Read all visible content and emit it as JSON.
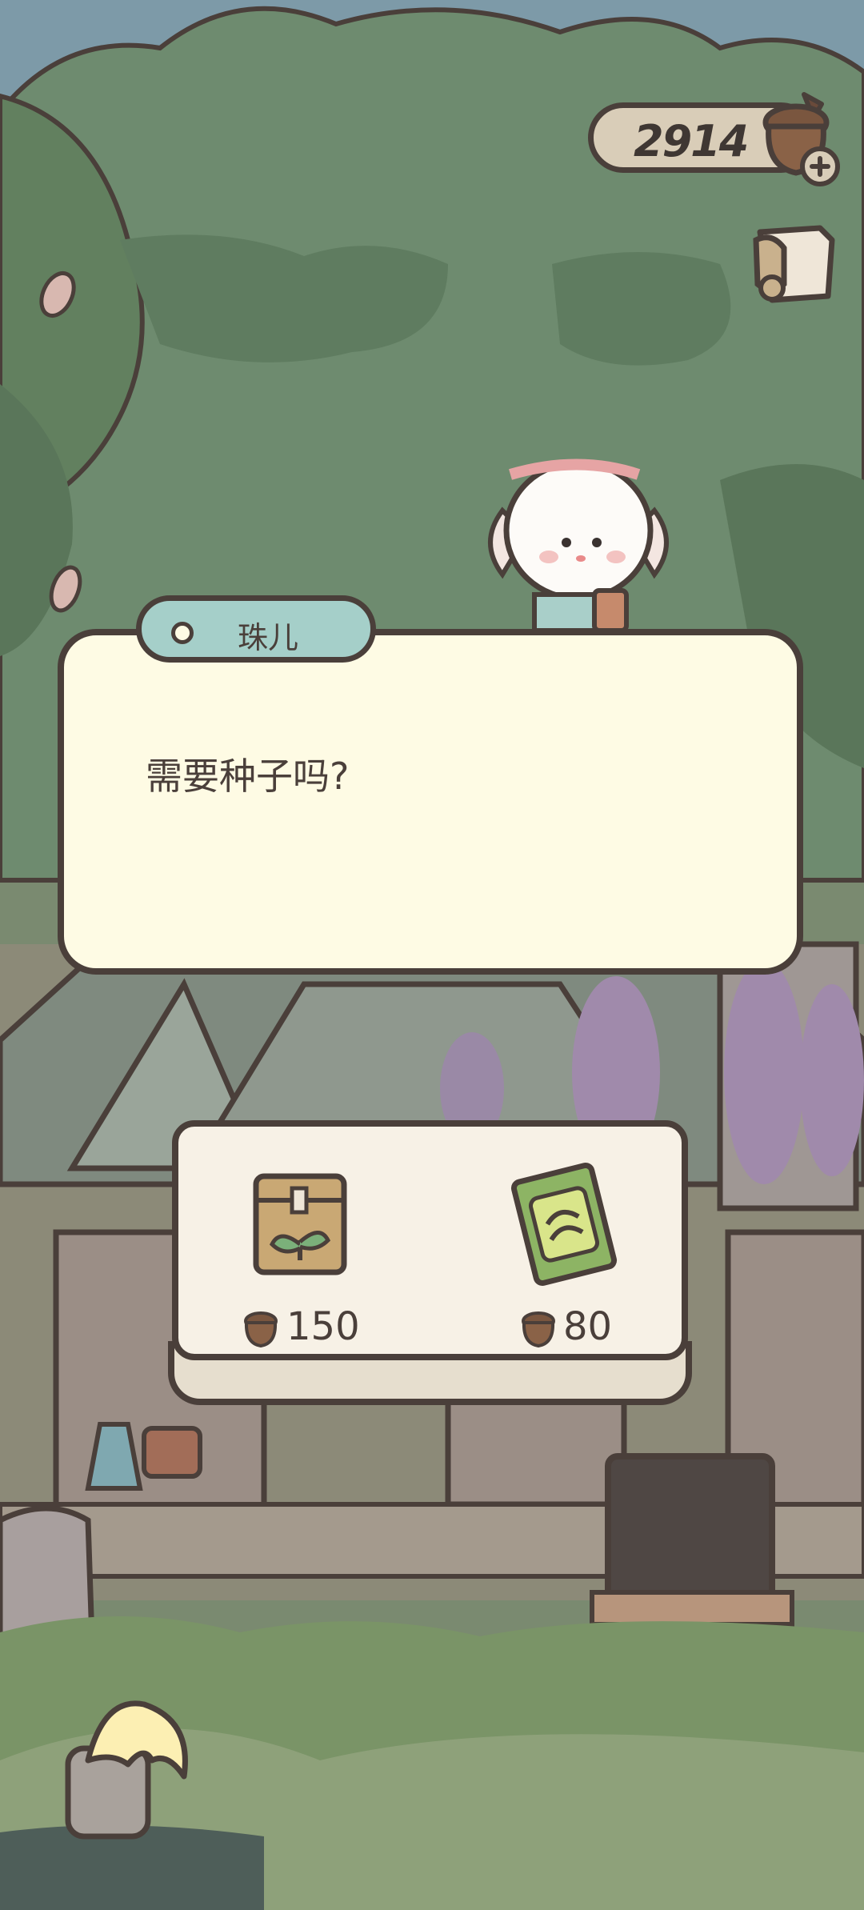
{
  "currency": {
    "amount": "2914",
    "icon": "acorn-icon",
    "add_icon": "plus-icon"
  },
  "dialog": {
    "speaker": "珠儿",
    "text": "需要种子吗?"
  },
  "shop": {
    "items": [
      {
        "name": "seed-bag",
        "icon": "seed-bag-icon",
        "price": "150"
      },
      {
        "name": "seed-packet",
        "icon": "seed-packet-icon",
        "price": "80"
      }
    ]
  },
  "colors": {
    "outline": "#4a3f3a",
    "dialog_bg": "#fefbe4",
    "name_tag_bg": "#a5cfc9",
    "foliage": "#6d8a6e"
  }
}
